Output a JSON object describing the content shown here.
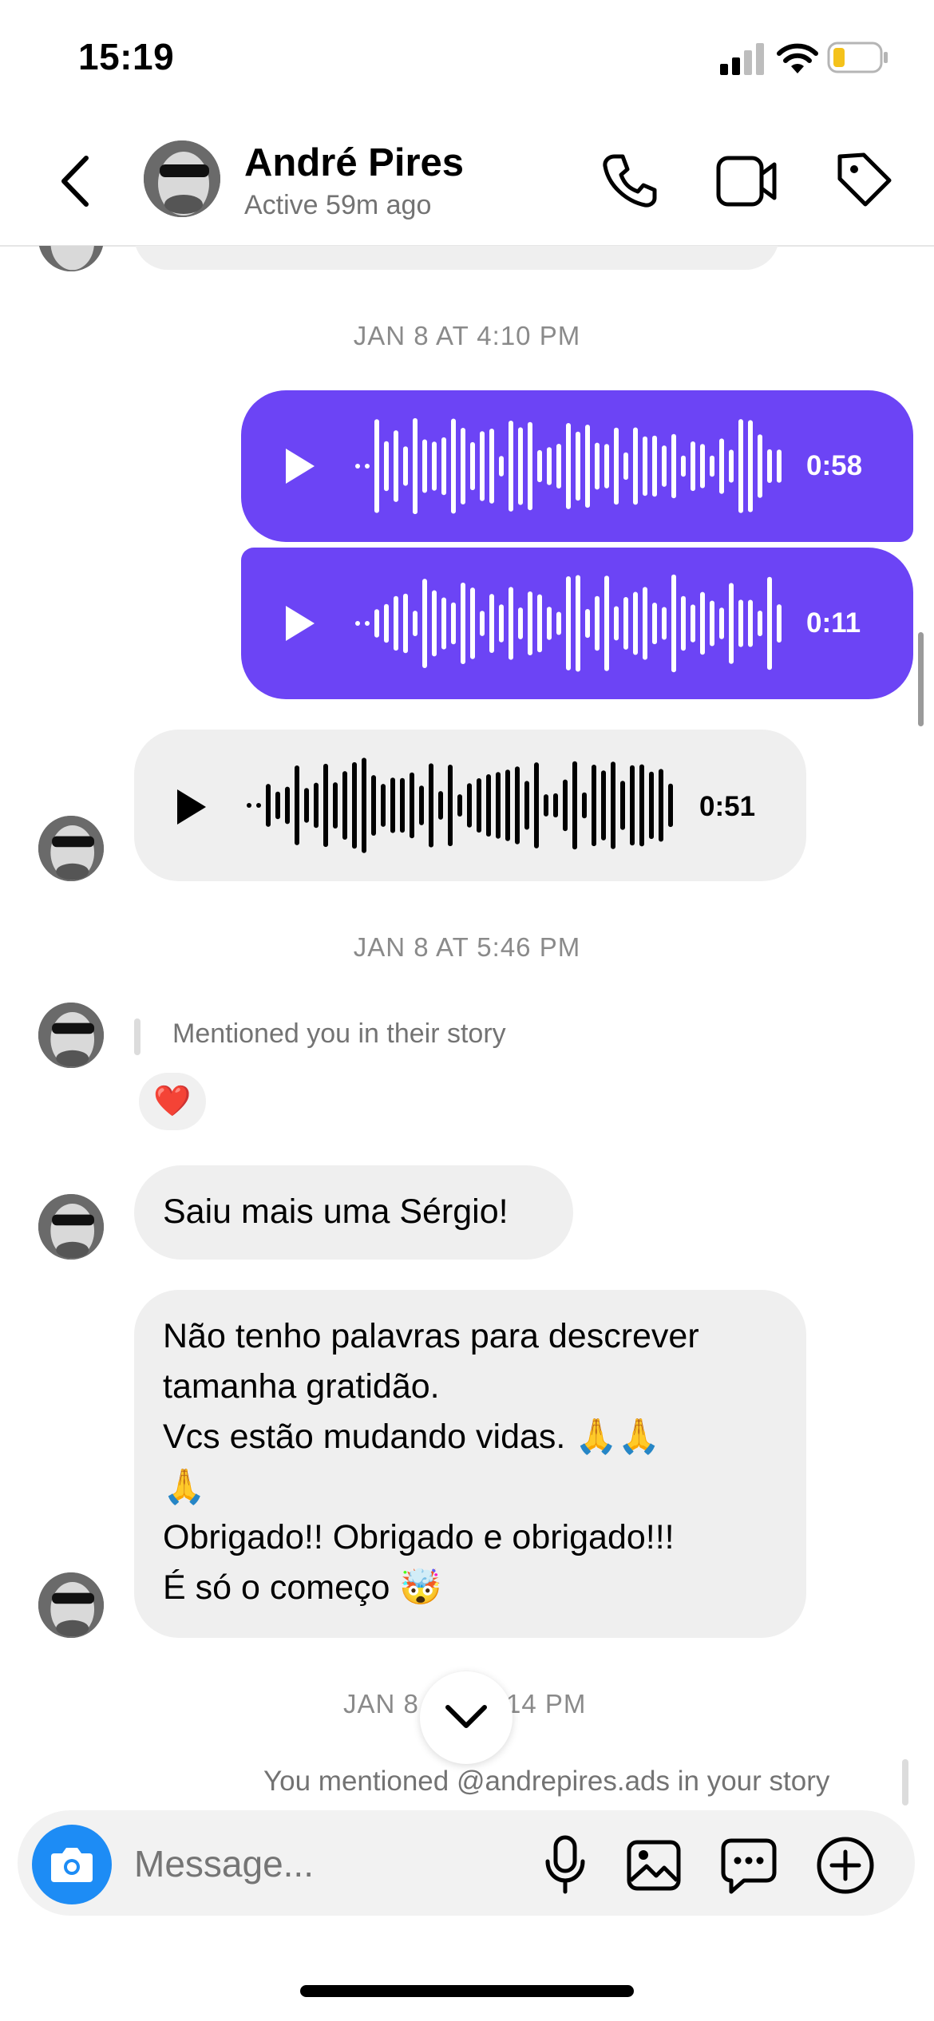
{
  "status_bar": {
    "time": "15:19"
  },
  "header": {
    "contact_name": "André Pires",
    "status": "Active 59m ago"
  },
  "chat": {
    "date_1": "JAN 8 AT 4:10 PM",
    "voice_1_duration": "0:58",
    "voice_2_duration": "0:11",
    "voice_3_duration": "0:51",
    "date_2": "JAN 8 AT 5:46 PM",
    "story_mention": "Mentioned you in their story",
    "story_reaction": "❤️",
    "message_1": "Saiu mais uma Sérgio!",
    "message_2_lines": [
      "Não tenho palavras para descrever",
      "tamanha gratidão.",
      "Vcs estão mudando vidas. 🙏🙏",
      "🙏",
      "Obrigado!! Obrigado e obrigado!!!",
      "É só o começo 🤯"
    ],
    "date_3_left": "JAN 8",
    "date_3_right": "14 PM",
    "own_mention": "You mentioned @andrepires.ads in your story"
  },
  "composer": {
    "placeholder": "Message..."
  },
  "colors": {
    "accent": "#6c44f5",
    "incoming": "#efefef",
    "camera": "#1d8cf5"
  }
}
